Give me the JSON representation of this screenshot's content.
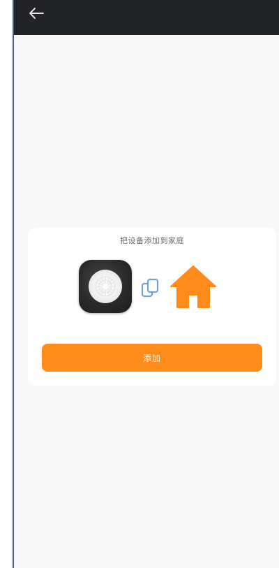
{
  "header": {
    "back_icon": "arrow-left-icon"
  },
  "card": {
    "title": "把设备添加到家庭",
    "device_image": "device-thumbnail",
    "link_icon": "copy-link-icon",
    "home_icon": "house-icon",
    "add_button_label": "添加"
  },
  "colors": {
    "accent": "#ff8c1a",
    "topbar": "#222326",
    "page_bg": "#f8f8f8",
    "card_bg": "#ffffff",
    "link_icon": "#6fa3d8"
  }
}
